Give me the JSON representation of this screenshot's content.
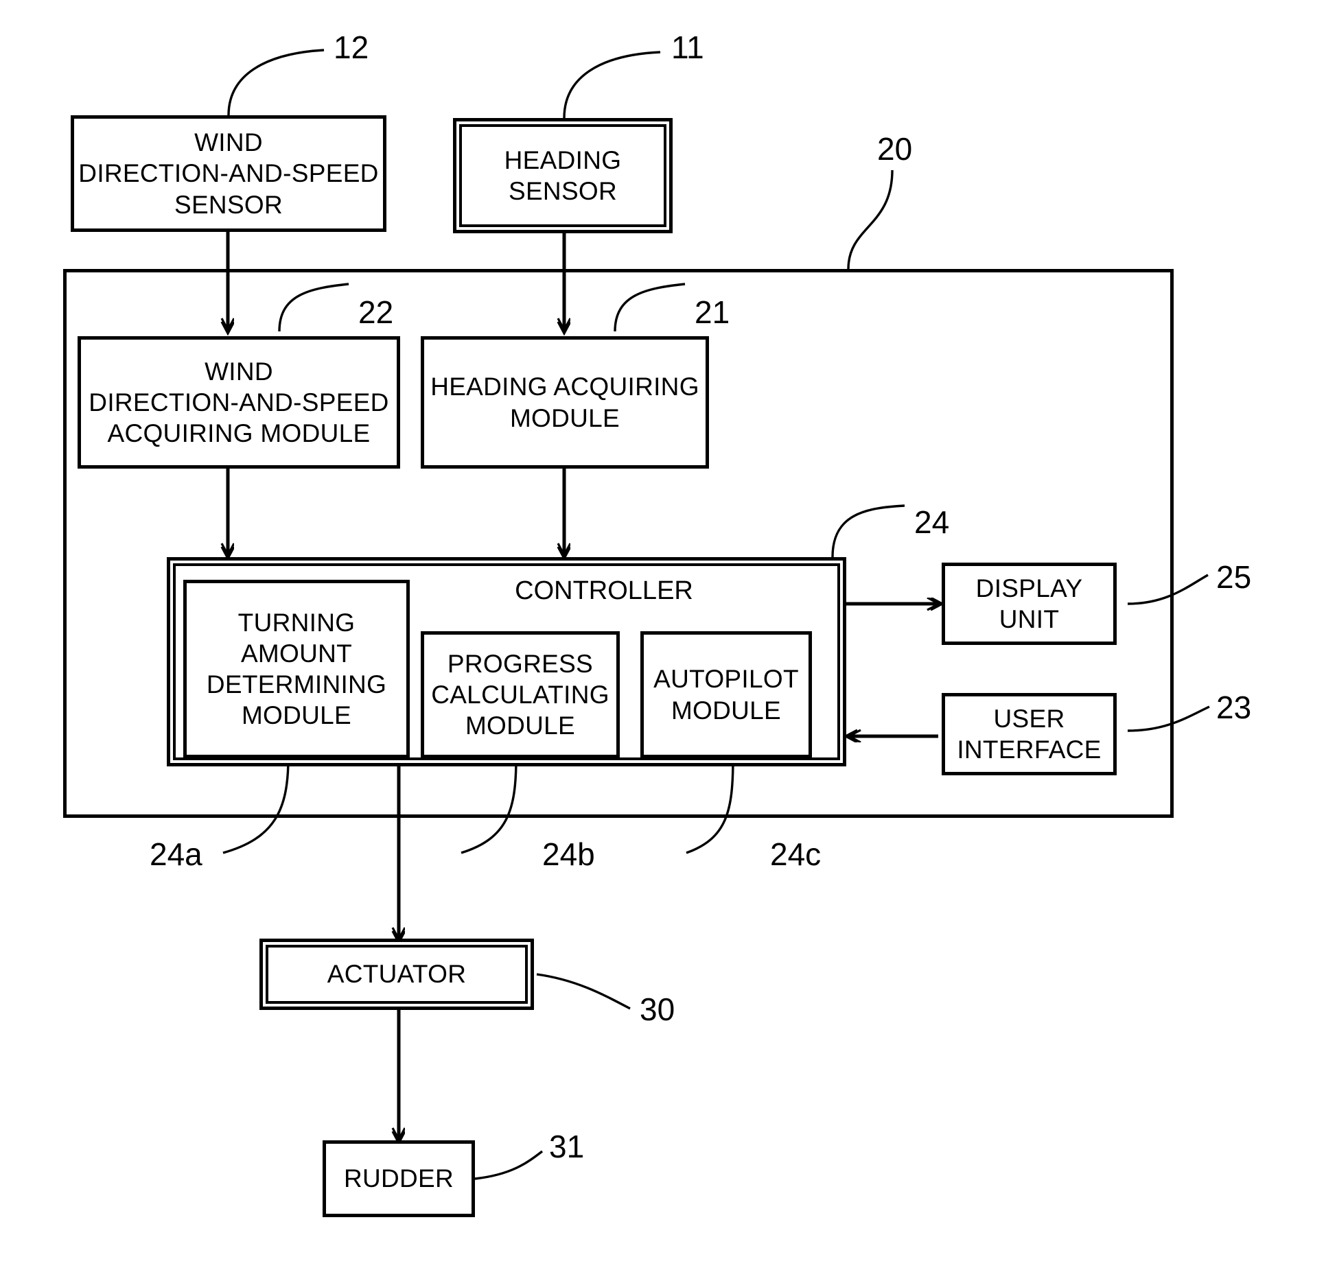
{
  "figure": {
    "type": "patent-block-diagram",
    "background": "#ffffff",
    "line_color": "#000000"
  },
  "blocks": {
    "wind_sensor": {
      "label": "WIND\nDIRECTION-AND-SPEED\nSENSOR",
      "ref": "12",
      "border": "single"
    },
    "heading_sensor": {
      "label": "HEADING\nSENSOR",
      "ref": "11",
      "border": "double"
    },
    "wind_acquiring_module": {
      "label": "WIND\nDIRECTION-AND-SPEED\nACQUIRING MODULE",
      "ref": "22",
      "border": "single"
    },
    "heading_acquiring_module": {
      "label": "HEADING ACQUIRING\nMODULE",
      "ref": "21",
      "border": "single"
    },
    "controller": {
      "label": "CONTROLLER",
      "ref": "24",
      "border": "double"
    },
    "turning_amount_module": {
      "label": "TURNING\nAMOUNT\nDETERMINING\nMODULE",
      "ref": "24a",
      "border": "single"
    },
    "progress_calculating_module": {
      "label": "PROGRESS\nCALCULATING\nMODULE",
      "ref": "24b",
      "border": "single"
    },
    "autopilot_module": {
      "label": "AUTOPILOT\nMODULE",
      "ref": "24c",
      "border": "single"
    },
    "display_unit": {
      "label": "DISPLAY\nUNIT",
      "ref": "25",
      "border": "single"
    },
    "user_interface": {
      "label": "USER\nINTERFACE",
      "ref": "23",
      "border": "single"
    },
    "actuator": {
      "label": "ACTUATOR",
      "ref": "30",
      "border": "double"
    },
    "rudder": {
      "label": "RUDDER",
      "ref": "31",
      "border": "single"
    },
    "system_enclosure": {
      "label": "",
      "ref": "20",
      "border": "single"
    }
  },
  "reference_numerals": {
    "n11": "11",
    "n12": "12",
    "n20": "20",
    "n21": "21",
    "n22": "22",
    "n23": "23",
    "n24": "24",
    "n24a": "24a",
    "n24b": "24b",
    "n24c": "24c",
    "n25": "25",
    "n30": "30",
    "n31": "31"
  },
  "connections": [
    {
      "from": "wind_sensor",
      "to": "wind_acquiring_module",
      "style": "arrow-down"
    },
    {
      "from": "heading_sensor",
      "to": "heading_acquiring_module",
      "style": "arrow-down"
    },
    {
      "from": "wind_acquiring_module",
      "to": "controller",
      "style": "arrow-down"
    },
    {
      "from": "heading_acquiring_module",
      "to": "controller",
      "style": "arrow-down"
    },
    {
      "from": "controller",
      "to": "display_unit",
      "style": "arrow-right"
    },
    {
      "from": "user_interface",
      "to": "controller",
      "style": "arrow-left"
    },
    {
      "from": "controller",
      "to": "actuator",
      "style": "arrow-down"
    },
    {
      "from": "actuator",
      "to": "rudder",
      "style": "arrow-down"
    }
  ]
}
